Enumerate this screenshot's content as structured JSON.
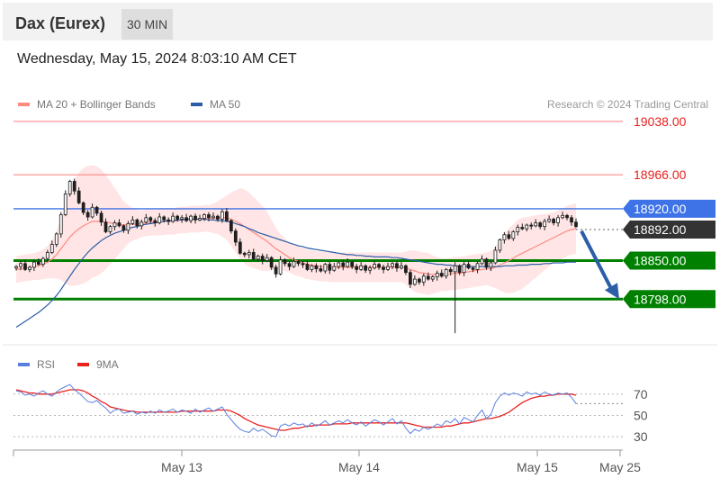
{
  "header": {
    "instrument": "Dax (Eurex)",
    "timeframe": "30 MIN"
  },
  "timestamp": "Wednesday, May 15, 2024 8:03:10 AM CET",
  "legend": {
    "ma20_label": "MA 20 + Bollinger Bands",
    "ma50_label": "MA 50",
    "credit": "Research © 2024 Trading Central",
    "rsi_label": "RSI",
    "rsi_ma_label": "9MA"
  },
  "colors": {
    "resistance": "#ff7b7b",
    "pivot": "#3d73e6",
    "support": "#008000",
    "current": "#333333",
    "ma20": "#ff8a80",
    "bollinger_fill": "#ffe0e0",
    "ma50": "#2c5ea8",
    "candle": "#1f1f1f",
    "rsi": "#5b7fe0",
    "rsi_ma": "#e8211e"
  },
  "chart_data": [
    {
      "type": "candlestick",
      "title": "Dax (Eurex) 30 MIN",
      "x_tick_labels": [
        "May 13",
        "May 14",
        "May 15",
        "May 25"
      ],
      "y_range": [
        18740,
        19050
      ],
      "levels": [
        {
          "value": 19038.0,
          "label": "19038.00",
          "kind": "resistance"
        },
        {
          "value": 18966.0,
          "label": "18966.00",
          "kind": "resistance"
        },
        {
          "value": 18920.0,
          "label": "18920.00",
          "kind": "pivot"
        },
        {
          "value": 18892.0,
          "label": "18892.00",
          "kind": "current"
        },
        {
          "value": 18850.0,
          "label": "18850.00",
          "kind": "support"
        },
        {
          "value": 18798.0,
          "label": "18798.00",
          "kind": "support"
        }
      ],
      "close": [
        18842,
        18846,
        18838,
        18841,
        18848,
        18845,
        18853,
        18861,
        18872,
        18886,
        18912,
        18940,
        18957,
        18944,
        18928,
        18915,
        18909,
        18922,
        18914,
        18902,
        18889,
        18896,
        18901,
        18897,
        18891,
        18900,
        18905,
        18897,
        18902,
        18908,
        18904,
        18901,
        18909,
        18905,
        18903,
        18910,
        18906,
        18908,
        18904,
        18910,
        18905,
        18907,
        18912,
        18908,
        18910,
        18906,
        18916,
        18904,
        18890,
        18875,
        18860,
        18858,
        18861,
        18852,
        18856,
        18850,
        18854,
        18841,
        18832,
        18851,
        18846,
        18842,
        18849,
        18846,
        18845,
        18838,
        18843,
        18839,
        18836,
        18845,
        18837,
        18842,
        18847,
        18842,
        18848,
        18842,
        18838,
        18843,
        18837,
        18840,
        18845,
        18841,
        18838,
        18842,
        18846,
        18840,
        18843,
        18834,
        18818,
        18825,
        18821,
        18829,
        18825,
        18828,
        18833,
        18829,
        18838,
        18835,
        18843,
        18834,
        18845,
        18840,
        18838,
        18846,
        18852,
        18841,
        18847,
        18864,
        18878,
        18885,
        18880,
        18889,
        18895,
        18893,
        18898,
        18897,
        18901,
        18896,
        18903,
        18906,
        18901,
        18908,
        18911,
        18908,
        18902,
        18896
      ],
      "ma20": [
        18838,
        18839,
        18840,
        18841,
        18842,
        18843,
        18845,
        18848,
        18852,
        18858,
        18866,
        18874,
        18882,
        18888,
        18893,
        18897,
        18900,
        18903,
        18903,
        18903,
        18902,
        18901,
        18900,
        18899,
        18898,
        18899,
        18899,
        18899,
        18900,
        18901,
        18902,
        18902,
        18902,
        18903,
        18903,
        18903,
        18904,
        18905,
        18905,
        18906,
        18906,
        18906,
        18907,
        18907,
        18907,
        18908,
        18908,
        18908,
        18906,
        18903,
        18900,
        18896,
        18892,
        18888,
        18884,
        18880,
        18876,
        18871,
        18866,
        18862,
        18858,
        18854,
        18851,
        18849,
        18847,
        18845,
        18844,
        18843,
        18842,
        18842,
        18841,
        18841,
        18841,
        18841,
        18841,
        18841,
        18841,
        18841,
        18841,
        18841,
        18841,
        18841,
        18841,
        18841,
        18841,
        18841,
        18841,
        18840,
        18838,
        18836,
        18834,
        18833,
        18832,
        18831,
        18831,
        18831,
        18831,
        18832,
        18833,
        18833,
        18834,
        18835,
        18836,
        18837,
        18838,
        18839,
        18839,
        18841,
        18844,
        18847,
        18850,
        18853,
        18857,
        18860,
        18863,
        18866,
        18869,
        18872,
        18875,
        18878,
        18881,
        18884,
        18887,
        18890,
        18892,
        18893
      ],
      "ma50": [
        18760,
        18764,
        18768,
        18772,
        18776,
        18780,
        18785,
        18790,
        18796,
        18803,
        18811,
        18820,
        18829,
        18838,
        18846,
        18854,
        18861,
        18867,
        18872,
        18877,
        18881,
        18884,
        18887,
        18889,
        18891,
        18893,
        18895,
        18896,
        18898,
        18899,
        18900,
        18901,
        18902,
        18903,
        18904,
        18904,
        18905,
        18905,
        18906,
        18906,
        18906,
        18906,
        18906,
        18905,
        18905,
        18904,
        18904,
        18903,
        18902,
        18900,
        18898,
        18896,
        18893,
        18891,
        18888,
        18886,
        18884,
        18882,
        18880,
        18878,
        18876,
        18874,
        18872,
        18870,
        18869,
        18867,
        18866,
        18865,
        18864,
        18863,
        18862,
        18861,
        18860,
        18859,
        18858,
        18858,
        18857,
        18857,
        18856,
        18856,
        18855,
        18855,
        18855,
        18855,
        18854,
        18854,
        18853,
        18852,
        18851,
        18850,
        18849,
        18848,
        18847,
        18846,
        18845,
        18845,
        18844,
        18844,
        18843,
        18843,
        18843,
        18842,
        18842,
        18842,
        18842,
        18842,
        18842,
        18842,
        18842,
        18843,
        18843,
        18843,
        18844,
        18844,
        18844,
        18845,
        18845,
        18845,
        18846,
        18846,
        18847,
        18847,
        18847,
        18848,
        18848,
        18848
      ],
      "bollinger_width": [
        18,
        18,
        18,
        18,
        18,
        19,
        20,
        22,
        26,
        32,
        42,
        55,
        66,
        72,
        76,
        78,
        78,
        76,
        74,
        70,
        64,
        56,
        48,
        40,
        32,
        26,
        22,
        20,
        18,
        18,
        18,
        18,
        18,
        18,
        18,
        18,
        18,
        18,
        18,
        18,
        18,
        18,
        18,
        18,
        20,
        22,
        26,
        30,
        36,
        42,
        48,
        50,
        50,
        48,
        46,
        44,
        40,
        34,
        28,
        24,
        22,
        20,
        20,
        20,
        20,
        20,
        20,
        20,
        20,
        20,
        20,
        20,
        20,
        20,
        20,
        20,
        20,
        20,
        20,
        20,
        20,
        20,
        20,
        20,
        20,
        20,
        20,
        22,
        26,
        28,
        28,
        28,
        28,
        26,
        24,
        22,
        22,
        22,
        22,
        22,
        22,
        22,
        22,
        22,
        22,
        22,
        24,
        28,
        34,
        40,
        44,
        46,
        48,
        48,
        46,
        44,
        42,
        40,
        38,
        36,
        34,
        34,
        34,
        34,
        34,
        34
      ]
    },
    {
      "type": "line",
      "title": "RSI",
      "x_tick_labels": [
        "May 13",
        "May 14",
        "May 15",
        "May 25"
      ],
      "y_ticks": [
        30,
        50,
        70
      ],
      "y_range": [
        20,
        85
      ],
      "series": [
        {
          "name": "RSI",
          "values": [
            73,
            72,
            69,
            70,
            68,
            71,
            73,
            70,
            68,
            72,
            75,
            77,
            79,
            74,
            71,
            67,
            63,
            62,
            64,
            60,
            57,
            52,
            55,
            56,
            52,
            53,
            54,
            51,
            53,
            52,
            54,
            52,
            55,
            53,
            54,
            56,
            53,
            55,
            54,
            52,
            56,
            53,
            55,
            57,
            54,
            56,
            58,
            51,
            46,
            41,
            37,
            35,
            34,
            38,
            35,
            37,
            34,
            31,
            30,
            40,
            42,
            40,
            43,
            41,
            42,
            39,
            43,
            40,
            42,
            45,
            41,
            43,
            45,
            43,
            46,
            43,
            41,
            44,
            40,
            43,
            46,
            44,
            41,
            44,
            47,
            42,
            45,
            38,
            33,
            37,
            35,
            39,
            37,
            39,
            42,
            40,
            45,
            43,
            47,
            42,
            48,
            46,
            44,
            50,
            55,
            47,
            51,
            62,
            68,
            71,
            69,
            71,
            70,
            68,
            72,
            70,
            71,
            69,
            72,
            70,
            69,
            71,
            70,
            71,
            67,
            61
          ]
        },
        {
          "name": "9MA",
          "values": [
            74,
            73,
            72,
            71,
            71,
            70,
            70,
            70,
            70,
            71,
            72,
            73,
            74,
            74,
            74,
            73,
            71,
            68,
            66,
            63,
            61,
            58,
            57,
            56,
            55,
            54,
            54,
            53,
            53,
            53,
            53,
            53,
            53,
            53,
            53,
            53,
            53,
            54,
            54,
            54,
            54,
            54,
            54,
            54,
            54,
            55,
            55,
            55,
            54,
            52,
            50,
            47,
            45,
            43,
            41,
            40,
            39,
            38,
            37,
            36,
            36,
            37,
            38,
            38,
            39,
            40,
            40,
            41,
            41,
            41,
            41,
            42,
            42,
            42,
            42,
            43,
            43,
            43,
            43,
            43,
            43,
            43,
            43,
            43,
            43,
            43,
            43,
            43,
            42,
            41,
            40,
            39,
            39,
            39,
            39,
            39,
            40,
            40,
            41,
            42,
            43,
            43,
            44,
            45,
            46,
            47,
            47,
            48,
            49,
            51,
            53,
            56,
            59,
            62,
            64,
            66,
            67,
            68,
            68,
            69,
            69,
            70,
            70,
            70,
            70,
            69
          ]
        }
      ]
    }
  ]
}
